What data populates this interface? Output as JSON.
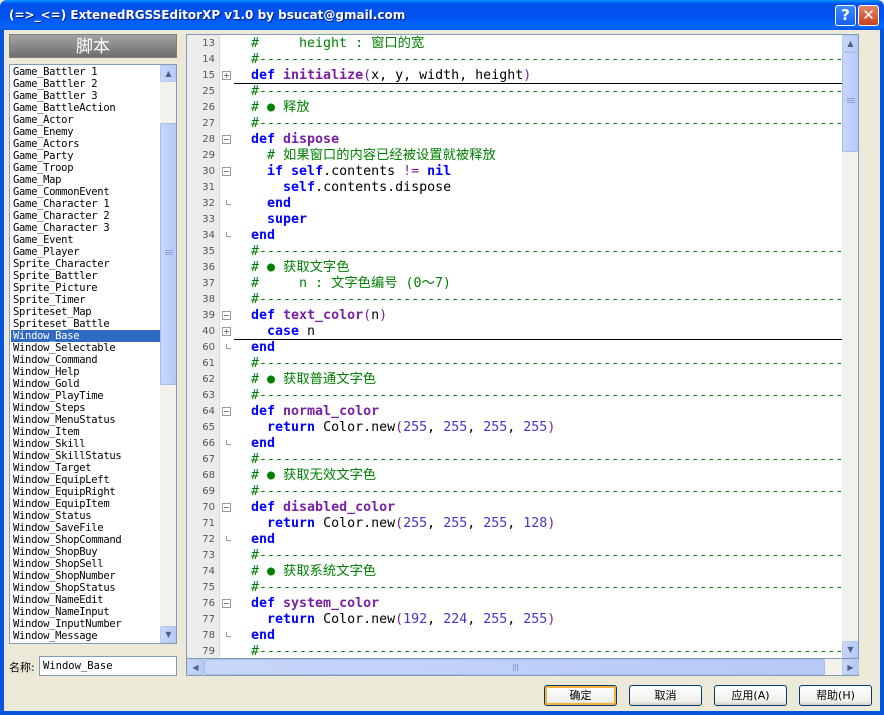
{
  "window": {
    "title": "(=>_<=) ExtenedRGSSEditorXP v1.0 by bsucat@gmail.com",
    "help_glyph": "?",
    "close_glyph": "✕"
  },
  "sidebar": {
    "header": "脚本",
    "selected": "Window_Base",
    "scripts": [
      "Game_Battler 1",
      "Game_Battler 2",
      "Game_Battler 3",
      "Game_BattleAction",
      "Game_Actor",
      "Game_Enemy",
      "Game_Actors",
      "Game_Party",
      "Game_Troop",
      "Game_Map",
      "Game_CommonEvent",
      "Game_Character 1",
      "Game_Character 2",
      "Game_Character 3",
      "Game_Event",
      "Game_Player",
      "Sprite_Character",
      "Sprite_Battler",
      "Sprite_Picture",
      "Sprite_Timer",
      "Spriteset_Map",
      "Spriteset_Battle",
      "Window_Base",
      "Window_Selectable",
      "Window_Command",
      "Window_Help",
      "Window_Gold",
      "Window_PlayTime",
      "Window_Steps",
      "Window_MenuStatus",
      "Window_Item",
      "Window_Skill",
      "Window_SkillStatus",
      "Window_Target",
      "Window_EquipLeft",
      "Window_EquipRight",
      "Window_EquipItem",
      "Window_Status",
      "Window_SaveFile",
      "Window_ShopCommand",
      "Window_ShopBuy",
      "Window_ShopSell",
      "Window_ShopNumber",
      "Window_ShopStatus",
      "Window_NameEdit",
      "Window_NameInput",
      "Window_InputNumber",
      "Window_Message"
    ],
    "name_label": "名称:",
    "name_value": "Window_Base"
  },
  "editor": {
    "lines": [
      {
        "n": "13",
        "fold": "",
        "tokens": [
          [
            "c",
            "#     height : 窗口的宽"
          ]
        ]
      },
      {
        "n": "14",
        "fold": "",
        "tokens": [
          [
            "c",
            "#--------------------------------------------------------------------------"
          ]
        ]
      },
      {
        "n": "15",
        "fold": "plus",
        "collapsed": true,
        "tokens": [
          [
            "k",
            "def "
          ],
          [
            "f",
            "initialize"
          ],
          [
            "s",
            "("
          ],
          [
            "p",
            "x, y, width, height"
          ],
          [
            "s",
            ")"
          ]
        ]
      },
      {
        "n": "25",
        "fold": "",
        "tokens": [
          [
            "c",
            "#--------------------------------------------------------------------------"
          ]
        ]
      },
      {
        "n": "26",
        "fold": "",
        "tokens": [
          [
            "c",
            "# ● 释放"
          ]
        ]
      },
      {
        "n": "27",
        "fold": "",
        "tokens": [
          [
            "c",
            "#--------------------------------------------------------------------------"
          ]
        ]
      },
      {
        "n": "28",
        "fold": "minus",
        "tokens": [
          [
            "k",
            "def "
          ],
          [
            "f",
            "dispose"
          ]
        ]
      },
      {
        "n": "29",
        "fold": "",
        "tokens": [
          [
            "p",
            "  "
          ],
          [
            "c",
            "# 如果窗口的内容已经被设置就被释放"
          ]
        ]
      },
      {
        "n": "30",
        "fold": "minus",
        "tokens": [
          [
            "p",
            "  "
          ],
          [
            "k",
            "if "
          ],
          [
            "k",
            "self"
          ],
          [
            "p",
            ".contents "
          ],
          [
            "s",
            "!="
          ],
          [
            "p",
            " "
          ],
          [
            "k",
            "nil"
          ]
        ]
      },
      {
        "n": "31",
        "fold": "",
        "tokens": [
          [
            "p",
            "    "
          ],
          [
            "k",
            "self"
          ],
          [
            "p",
            ".contents.dispose"
          ]
        ]
      },
      {
        "n": "32",
        "fold": "end",
        "tokens": [
          [
            "p",
            "  "
          ],
          [
            "k",
            "end"
          ]
        ]
      },
      {
        "n": "33",
        "fold": "",
        "tokens": [
          [
            "p",
            "  "
          ],
          [
            "k",
            "super"
          ]
        ]
      },
      {
        "n": "34",
        "fold": "end",
        "tokens": [
          [
            "k",
            "end"
          ]
        ]
      },
      {
        "n": "35",
        "fold": "",
        "tokens": [
          [
            "c",
            "#--------------------------------------------------------------------------"
          ]
        ]
      },
      {
        "n": "36",
        "fold": "",
        "tokens": [
          [
            "c",
            "# ● 获取文字色"
          ]
        ]
      },
      {
        "n": "37",
        "fold": "",
        "tokens": [
          [
            "c",
            "#     n : 文字色编号 (0～7)"
          ]
        ]
      },
      {
        "n": "38",
        "fold": "",
        "tokens": [
          [
            "c",
            "#--------------------------------------------------------------------------"
          ]
        ]
      },
      {
        "n": "39",
        "fold": "minus",
        "tokens": [
          [
            "k",
            "def "
          ],
          [
            "f",
            "text_color"
          ],
          [
            "s",
            "("
          ],
          [
            "p",
            "n"
          ],
          [
            "s",
            ")"
          ]
        ]
      },
      {
        "n": "40",
        "fold": "plus",
        "collapsed": true,
        "tokens": [
          [
            "p",
            "  "
          ],
          [
            "k",
            "case "
          ],
          [
            "p",
            "n"
          ]
        ]
      },
      {
        "n": "60",
        "fold": "end",
        "tokens": [
          [
            "k",
            "end"
          ]
        ]
      },
      {
        "n": "61",
        "fold": "",
        "tokens": [
          [
            "c",
            "#--------------------------------------------------------------------------"
          ]
        ]
      },
      {
        "n": "62",
        "fold": "",
        "tokens": [
          [
            "c",
            "# ● 获取普通文字色"
          ]
        ]
      },
      {
        "n": "63",
        "fold": "",
        "tokens": [
          [
            "c",
            "#--------------------------------------------------------------------------"
          ]
        ]
      },
      {
        "n": "64",
        "fold": "minus",
        "tokens": [
          [
            "k",
            "def "
          ],
          [
            "f",
            "normal_color"
          ]
        ]
      },
      {
        "n": "65",
        "fold": "",
        "tokens": [
          [
            "p",
            "  "
          ],
          [
            "k",
            "return "
          ],
          [
            "p",
            "Color.new"
          ],
          [
            "s",
            "("
          ],
          [
            "d",
            "255"
          ],
          [
            "p",
            ", "
          ],
          [
            "d",
            "255"
          ],
          [
            "p",
            ", "
          ],
          [
            "d",
            "255"
          ],
          [
            "p",
            ", "
          ],
          [
            "d",
            "255"
          ],
          [
            "s",
            ")"
          ]
        ]
      },
      {
        "n": "66",
        "fold": "end",
        "tokens": [
          [
            "k",
            "end"
          ]
        ]
      },
      {
        "n": "67",
        "fold": "",
        "tokens": [
          [
            "c",
            "#--------------------------------------------------------------------------"
          ]
        ]
      },
      {
        "n": "68",
        "fold": "",
        "tokens": [
          [
            "c",
            "# ● 获取无效文字色"
          ]
        ]
      },
      {
        "n": "69",
        "fold": "",
        "tokens": [
          [
            "c",
            "#--------------------------------------------------------------------------"
          ]
        ]
      },
      {
        "n": "70",
        "fold": "minus",
        "tokens": [
          [
            "k",
            "def "
          ],
          [
            "f",
            "disabled_color"
          ]
        ]
      },
      {
        "n": "71",
        "fold": "",
        "tokens": [
          [
            "p",
            "  "
          ],
          [
            "k",
            "return "
          ],
          [
            "p",
            "Color.new"
          ],
          [
            "s",
            "("
          ],
          [
            "d",
            "255"
          ],
          [
            "p",
            ", "
          ],
          [
            "d",
            "255"
          ],
          [
            "p",
            ", "
          ],
          [
            "d",
            "255"
          ],
          [
            "p",
            ", "
          ],
          [
            "d",
            "128"
          ],
          [
            "s",
            ")"
          ]
        ]
      },
      {
        "n": "72",
        "fold": "end",
        "tokens": [
          [
            "k",
            "end"
          ]
        ]
      },
      {
        "n": "73",
        "fold": "",
        "tokens": [
          [
            "c",
            "#--------------------------------------------------------------------------"
          ]
        ]
      },
      {
        "n": "74",
        "fold": "",
        "tokens": [
          [
            "c",
            "# ● 获取系统文字色"
          ]
        ]
      },
      {
        "n": "75",
        "fold": "",
        "tokens": [
          [
            "c",
            "#--------------------------------------------------------------------------"
          ]
        ]
      },
      {
        "n": "76",
        "fold": "minus",
        "tokens": [
          [
            "k",
            "def "
          ],
          [
            "f",
            "system_color"
          ]
        ]
      },
      {
        "n": "77",
        "fold": "",
        "tokens": [
          [
            "p",
            "  "
          ],
          [
            "k",
            "return "
          ],
          [
            "p",
            "Color.new"
          ],
          [
            "s",
            "("
          ],
          [
            "d",
            "192"
          ],
          [
            "p",
            ", "
          ],
          [
            "d",
            "224"
          ],
          [
            "p",
            ", "
          ],
          [
            "d",
            "255"
          ],
          [
            "p",
            ", "
          ],
          [
            "d",
            "255"
          ],
          [
            "s",
            ")"
          ]
        ]
      },
      {
        "n": "78",
        "fold": "end",
        "tokens": [
          [
            "k",
            "end"
          ]
        ]
      },
      {
        "n": "79",
        "fold": "",
        "tokens": [
          [
            "c",
            "#--------------------------------------------------------------------------"
          ]
        ]
      }
    ]
  },
  "buttons": {
    "ok": "确定",
    "cancel": "取消",
    "apply": "应用(A)",
    "help": "帮助(H)"
  },
  "scrollbar_glyphs": {
    "up": "▲",
    "down": "▼",
    "left": "◀",
    "right": "▶"
  },
  "colors": {
    "comment": "#008000",
    "keyword": "#0000ff",
    "method": "#7b1fa2",
    "number": "#4b30c8",
    "selection": "#316ac5"
  }
}
